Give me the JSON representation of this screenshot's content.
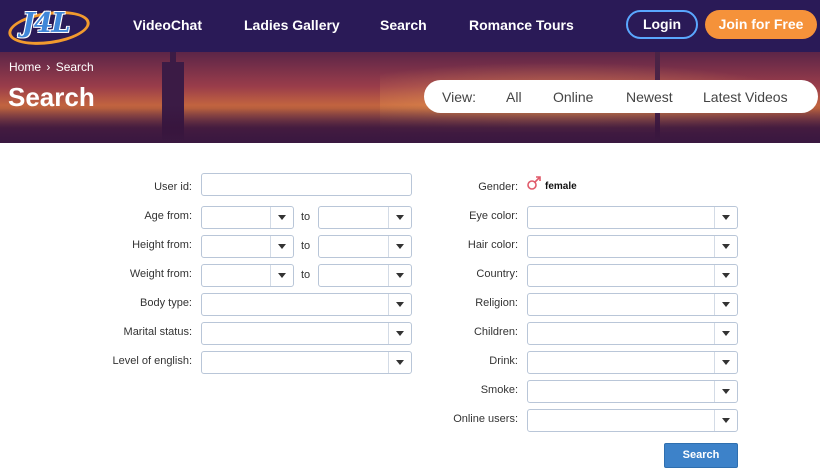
{
  "logo": {
    "text": "J4L"
  },
  "nav": {
    "items": [
      {
        "label": "VideoChat"
      },
      {
        "label": "Ladies Gallery"
      },
      {
        "label": "Search"
      },
      {
        "label": "Romance Tours"
      }
    ],
    "login_label": "Login",
    "join_label": "Join for Free"
  },
  "hero": {
    "breadcrumb": {
      "home": "Home",
      "separator": "›",
      "current": "Search"
    },
    "title": "Search",
    "view": {
      "label": "View:",
      "options": [
        "All",
        "Online",
        "Newest",
        "Latest Videos"
      ]
    }
  },
  "form": {
    "left": {
      "user_id_label": "User id:",
      "age_label": "Age from:",
      "height_label": "Height from:",
      "weight_label": "Weight from:",
      "to_label": "to",
      "body_type_label": "Body type:",
      "marital_status_label": "Marital status:",
      "english_label": "Level of english:"
    },
    "right": {
      "gender_label": "Gender:",
      "gender_value": "female",
      "eye_color_label": "Eye color:",
      "hair_color_label": "Hair color:",
      "country_label": "Country:",
      "religion_label": "Religion:",
      "children_label": "Children:",
      "drink_label": "Drink:",
      "smoke_label": "Smoke:",
      "online_users_label": "Online users:"
    },
    "submit_label": "Search"
  },
  "colors": {
    "nav_bg": "#2a1a57",
    "join_button": "#f5923a",
    "login_border": "#5aa7ff",
    "search_button": "#3d82c9",
    "gender_icon": "#e05a6a"
  }
}
